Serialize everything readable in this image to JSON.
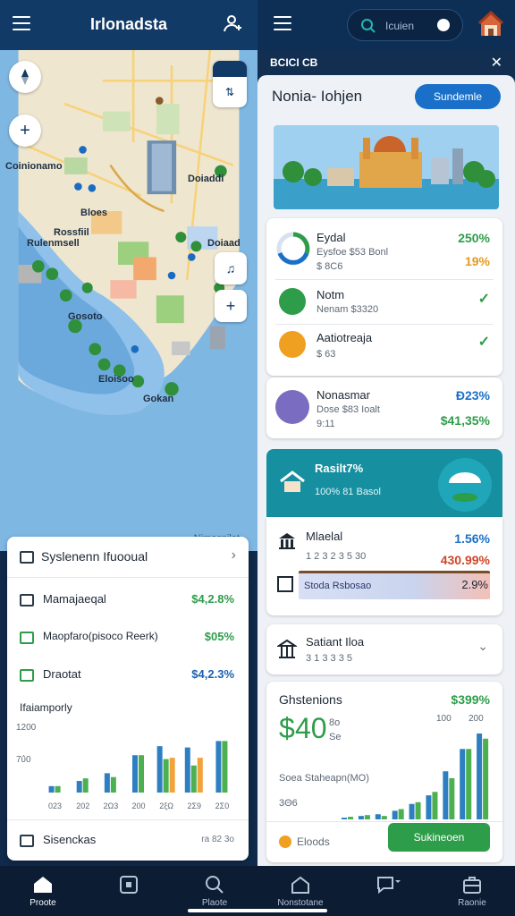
{
  "topbar": {
    "title": "Irlonadsta",
    "search_text": "Icuien"
  },
  "map": {
    "labels": {
      "a": "Coinionamo",
      "b": "Rossfiil",
      "c": "Rulenmsell",
      "d": "Doiaddi",
      "e": "Gosoto",
      "f": "Bloes",
      "g": "Doiaad",
      "h": "Eloisoo",
      "i": "Gokan",
      "water": "Nimocpilat"
    }
  },
  "left_card": {
    "header": "Syslenenn Ifuooual",
    "rows": [
      {
        "name": "Mamajaeqal",
        "value": "$4,2.8%",
        "color": "#2e9d4a"
      },
      {
        "name": "Maopfaro(pisoco Reerk)",
        "value": "$05%",
        "color": "#2e9d4a"
      },
      {
        "name": "Draotat",
        "value": "$4,2.3%",
        "color": "#1a62b0"
      }
    ],
    "chart_title": "Ifaiamporly",
    "footer_label": "Sisenckas",
    "footer_value": "ra 82 3o"
  },
  "chart_data": [
    {
      "type": "bar",
      "y_tick_labels": [
        "1200",
        "7ΰ0"
      ],
      "categories": [
        "023",
        "202",
        "2Ω3",
        "200",
        "2ξΩ",
        "2Σ9",
        "2Σ0"
      ],
      "series": [
        {
          "values": [
            10,
            18,
            30,
            58,
            72,
            70,
            80
          ],
          "color": "#2d7fc1"
        },
        {
          "values": [
            10,
            22,
            24,
            58,
            52,
            42,
            80
          ],
          "color": "#4caf50"
        },
        {
          "values": [
            0,
            0,
            0,
            0,
            54,
            54,
            0
          ],
          "color": "#f2a23a"
        }
      ]
    },
    {
      "type": "bar",
      "title": "Ghstenions",
      "y_tick_labels": [
        "100",
        "200",
        "3ΘΘ"
      ],
      "series": [
        {
          "values": [
            2,
            4,
            6,
            10,
            18,
            28,
            56,
            82,
            100
          ],
          "color": "#2d7fc1"
        },
        {
          "values": [
            3,
            5,
            4,
            12,
            20,
            32,
            48,
            82,
            94
          ],
          "color": "#4caf50"
        }
      ]
    }
  ],
  "right_panel": {
    "header": "BCICI CB",
    "title": "Nonia- Iohjen",
    "action_button": "Sundemle",
    "card1": [
      {
        "title": "Eydal",
        "sub1": "Eysfoe $53 Bonl",
        "sub2": "$ 8C6",
        "value1": "250%",
        "value2": "19%",
        "color1": "#2e9d4a",
        "color2": "#e49a1f"
      },
      {
        "title": "Notm",
        "sub1": "Nenam $3320",
        "check": "✓"
      },
      {
        "title": "Aatiotreaja",
        "sub1": "$ 63",
        "check": "✓"
      }
    ],
    "card2": {
      "title": "Nonasmar",
      "sub1": "Dose $83 Ioalt",
      "sub2": "9:11",
      "value1": "Đ23%",
      "value2": "$41,35%"
    },
    "teal": {
      "title": "Rasilt7%",
      "sub": "100% 81 Basol"
    },
    "detail": {
      "title": "Mlaelal",
      "sub": "1 2 3 2 3 5 30",
      "value1": "1.56%",
      "value2": "430.99%",
      "bar_label": "Stoda Rsbosao",
      "bar_value": "2.9%"
    },
    "accordion": {
      "title": "Satiant Iloa",
      "sub": "3 1 3 3 3 5"
    },
    "stats": {
      "title": "Ghstenions",
      "value_top": "$399%",
      "big": "40",
      "big_prefix": "$",
      "big_sub1": "8o",
      "big_sub2": "Se",
      "subtitle": "Soea Staheapn(MO)",
      "y_label": "3Θ6",
      "foot_label": "Eloods",
      "next_button": "Sukineoen"
    }
  },
  "bottom_nav": [
    {
      "label": "Proote",
      "active": true
    },
    {
      "label": "",
      "active": false
    },
    {
      "label": "Plaote",
      "active": false
    },
    {
      "label": "Nonstotane",
      "active": false
    },
    {
      "label": "",
      "active": false
    },
    {
      "label": "Raonie",
      "active": false
    }
  ]
}
